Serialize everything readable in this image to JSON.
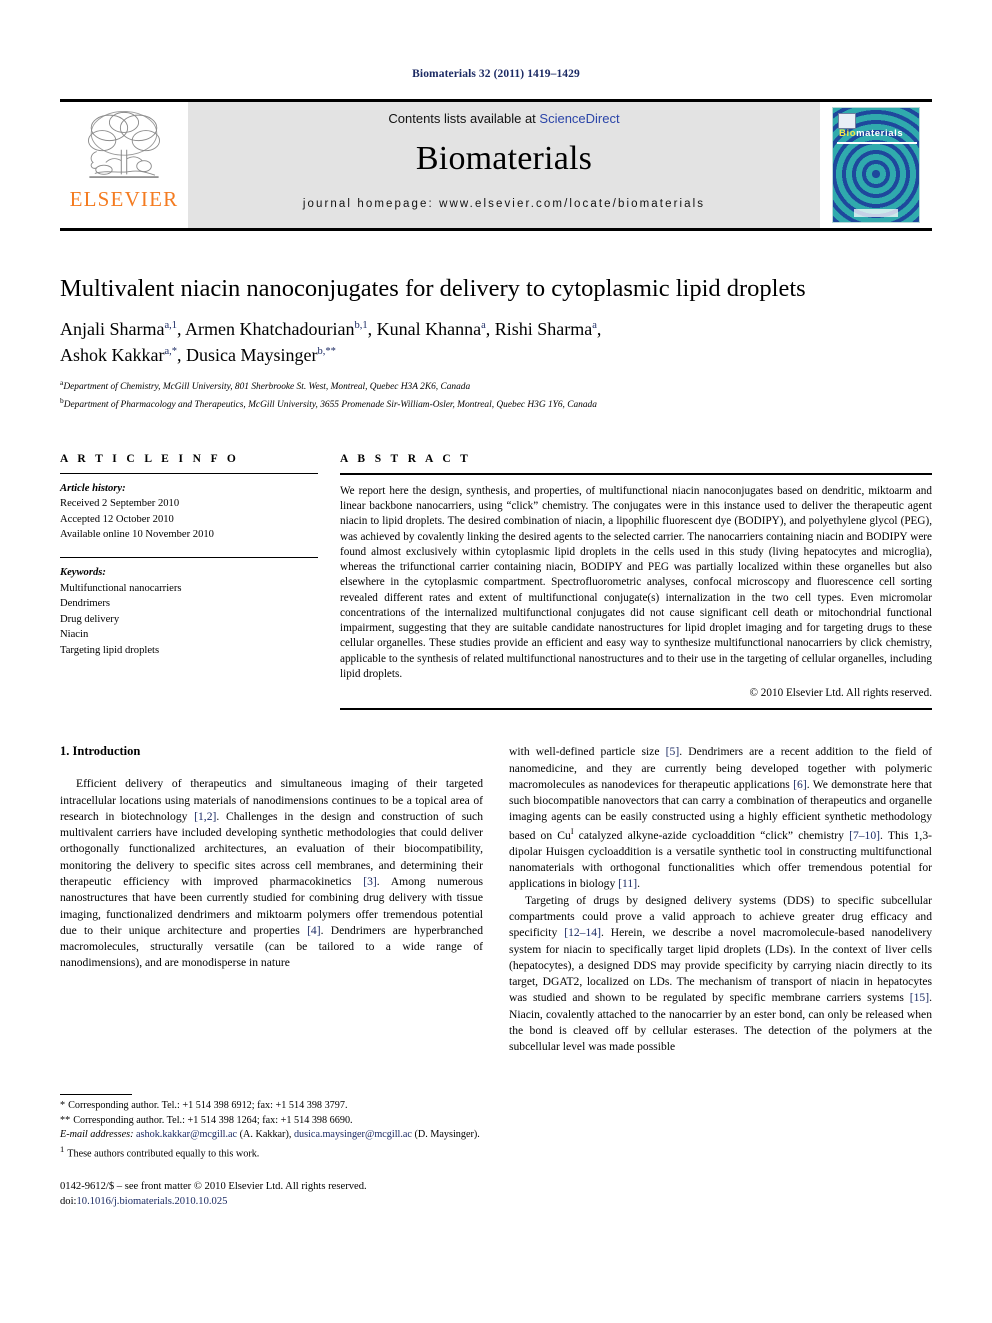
{
  "running_head": "Biomaterials 32 (2011) 1419–1429",
  "masthead": {
    "publisher_name": "ELSEVIER",
    "contents_prefix": "Contents lists available at ",
    "contents_link": "ScienceDirect",
    "journal_title": "Biomaterials",
    "homepage": "journal homepage: www.elsevier.com/locate/biomaterials",
    "cover": {
      "title_part1": "Bio",
      "title_part2": "materials"
    }
  },
  "article": {
    "title": "Multivalent niacin nanoconjugates for delivery to cytoplasmic lipid droplets",
    "authors_line1": "Anjali Sharma",
    "authors": [
      {
        "name": "Anjali Sharma",
        "sup": "a,1"
      },
      {
        "name": "Armen Khatchadourian",
        "sup": "b,1"
      },
      {
        "name": "Kunal Khanna",
        "sup": "a"
      },
      {
        "name": "Rishi Sharma",
        "sup": "a"
      },
      {
        "name": "Ashok Kakkar",
        "sup": "a,*"
      },
      {
        "name": "Dusica Maysinger",
        "sup": "b,**"
      }
    ],
    "affiliations": [
      {
        "mark": "a",
        "text": "Department of Chemistry, McGill University, 801 Sherbrooke St. West, Montreal, Quebec H3A 2K6, Canada"
      },
      {
        "mark": "b",
        "text": "Department of Pharmacology and Therapeutics, McGill University, 3655 Promenade Sir-William-Osler, Montreal, Quebec H3G 1Y6, Canada"
      }
    ]
  },
  "article_info": {
    "heading": "A R T I C L E   I N F O",
    "history_label": "Article history:",
    "history": [
      "Received 2 September 2010",
      "Accepted 12 October 2010",
      "Available online 10 November 2010"
    ],
    "keywords_label": "Keywords:",
    "keywords": [
      "Multifunctional nanocarriers",
      "Dendrimers",
      "Drug delivery",
      "Niacin",
      "Targeting lipid droplets"
    ]
  },
  "abstract": {
    "heading": "A B S T R A C T",
    "text": "We report here the design, synthesis, and properties, of multifunctional niacin nanoconjugates based on dendritic, miktoarm and linear backbone nanocarriers, using “click” chemistry. The conjugates were in this instance used to deliver the therapeutic agent niacin to lipid droplets. The desired combination of niacin, a lipophilic fluorescent dye (BODIPY), and polyethylene glycol (PEG), was achieved by covalently linking the desired agents to the selected carrier. The nanocarriers containing niacin and BODIPY were found almost exclusively within cytoplasmic lipid droplets in the cells used in this study (living hepatocytes and microglia), whereas the trifunctional carrier containing niacin, BODIPY and PEG was partially localized within these organelles but also elsewhere in the cytoplasmic compartment. Spectrofluorometric analyses, confocal microscopy and fluorescence cell sorting revealed different rates and extent of multifunctional conjugate(s) internalization in the two cell types. Even micromolar concentrations of the internalized multifunctional conjugates did not cause significant cell death or mitochondrial functional impairment, suggesting that they are suitable candidate nanostructures for lipid droplet imaging and for targeting drugs to these cellular organelles. These studies provide an efficient and easy way to synthesize multifunctional nanocarriers by click chemistry, applicable to the synthesis of related multifunctional nanostructures and to their use in the targeting of cellular organelles, including lipid droplets.",
    "copyright": "© 2010 Elsevier Ltd. All rights reserved."
  },
  "introduction": {
    "heading": "1. Introduction",
    "left_paragraphs": [
      "Efficient delivery of therapeutics and simultaneous imaging of their targeted intracellular locations using materials of nanodimensions continues to be a topical area of research in biotechnology [1,2]. Challenges in the design and construction of such multivalent carriers have included developing synthetic methodologies that could deliver orthogonally functionalized architectures, an evaluation of their biocompatibility, monitoring the delivery to specific sites across cell membranes, and determining their therapeutic efficiency with improved pharmacokinetics [3]. Among numerous nanostructures that have been currently studied for combining drug delivery with tissue imaging, functionalized dendrimers and miktoarm polymers offer tremendous potential due to their unique architecture and properties [4]. Dendrimers are hyperbranched macromolecules, structurally versatile (can be tailored to a wide range of nanodimensions), and are monodisperse in nature"
    ],
    "right_paragraphs": [
      "with well-defined particle size [5]. Dendrimers are a recent addition to the field of nanomedicine, and they are currently being developed together with polymeric macromolecules as nanodevices for therapeutic applications [6]. We demonstrate here that such biocompatible nanovectors that can carry a combination of therapeutics and organelle imaging agents can be easily constructed using a highly efficient synthetic methodology based on CuI catalyzed alkyne-azide cycloaddition “click” chemistry [7–10]. This 1,3-dipolar Huisgen cycloaddition is a versatile synthetic tool in constructing multifunctional nanomaterials with orthogonal functionalities which offer tremendous potential for applications in biology [11].",
      "Targeting of drugs by designed delivery systems (DDS) to specific subcellular compartments could prove a valid approach to achieve greater drug efficacy and specificity [12–14]. Herein, we describe a novel macromolecule-based nanodelivery system for niacin to specifically target lipid droplets (LDs). In the context of liver cells (hepatocytes), a designed DDS may provide specificity by carrying niacin directly to its target, DGAT2, localized on LDs. The mechanism of transport of niacin in hepatocytes was studied and shown to be regulated by specific membrane carriers systems [15]. Niacin, covalently attached to the nanocarrier by an ester bond, can only be released when the bond is cleaved off by cellular esterases. The detection of the polymers at the subcellular level was made possible"
    ]
  },
  "footnotes": {
    "corresponding1": "Corresponding author. Tel.: +1 514 398 6912; fax: +1 514 398 3797.",
    "corresponding1_mark": "*",
    "corresponding2": "Corresponding author. Tel.: +1 514 398 1264; fax: +1 514 398 6690.",
    "corresponding2_mark": "**",
    "email_label": "E-mail addresses:",
    "email1": "ashok.kakkar@mcgill.ac",
    "email1_owner": "(A. Kakkar)",
    "email2": "dusica.maysinger@mcgill.ac",
    "email2_owner": "(D. Maysinger).",
    "equal_mark": "1",
    "equal_contribution": "These authors contributed equally to this work.",
    "imprint": "0142-9612/$ – see front matter © 2010 Elsevier Ltd. All rights reserved.",
    "doi_label": "doi:",
    "doi_value": "10.1016/j.biomaterials.2010.10.025"
  },
  "colors": {
    "link_blue": "#1b2a63",
    "sciencedirect_blue": "#2b45a8",
    "elsevier_orange": "#F47B20",
    "band_gray": "#e3e3e3"
  }
}
